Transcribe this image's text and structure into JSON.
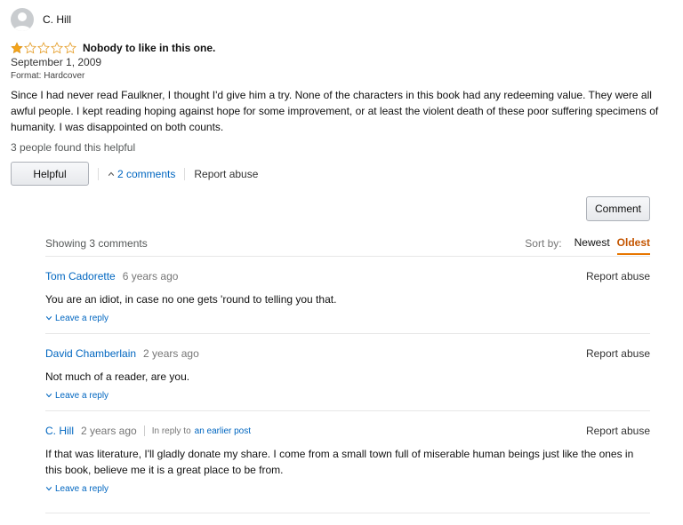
{
  "review": {
    "author": "C. Hill",
    "rating": 1,
    "rating_max": 5,
    "title": "Nobody to like in this one.",
    "date": "September 1, 2009",
    "format": "Format: Hardcover",
    "body": "Since I had never read Faulkner, I thought I'd give him a try. None of the characters in this book had any redeeming value. They were all awful people. I kept reading hoping against hope for some improvement, or at least the violent death of these poor suffering specimens of humanity. I was disappointed on both counts.",
    "helpful_text": "3 people found this helpful",
    "helpful_button": "Helpful",
    "comments_link": "2 comments",
    "report_abuse": "Report abuse"
  },
  "comment_button": "Comment",
  "comments_section": {
    "showing": "Showing 3 comments",
    "sort_label": "Sort by:",
    "sort_options": [
      "Newest",
      "Oldest"
    ],
    "sort_active": "Oldest",
    "items": [
      {
        "author": "Tom Cadorette",
        "time": "6 years ago",
        "text": "You are an idiot, in case no one gets 'round to telling you that.",
        "report": "Report abuse",
        "leave_reply": "Leave a reply"
      },
      {
        "author": "David Chamberlain",
        "time": "2 years ago",
        "text": "Not much of a reader, are you.",
        "report": "Report abuse",
        "leave_reply": "Leave a reply"
      },
      {
        "author": "C. Hill",
        "time": "2 years ago",
        "in_reply_to": "In reply to",
        "earlier_post": "an earlier post",
        "text": "If that was literature, I'll gladly donate my share. I come from a small town full of miserable human beings just like the ones in this book, believe me it is a great place to be from.",
        "report": "Report abuse",
        "leave_reply": "Leave a reply"
      }
    ]
  },
  "colors": {
    "link": "#0066c0",
    "star": "#f4a41a",
    "active_sort": "#c45500"
  }
}
